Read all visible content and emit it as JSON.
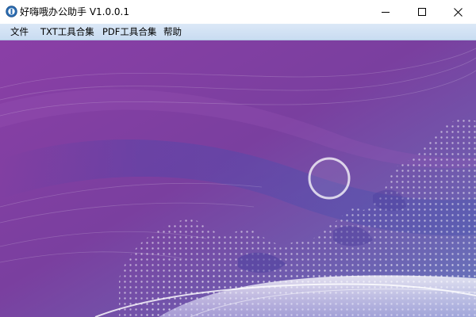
{
  "window": {
    "title": "好嗨哦办公助手 V1.0.0.1",
    "app_icon": "app-icon",
    "controls": {
      "minimize_icon": "minimize-icon",
      "maximize_icon": "maximize-icon",
      "close_icon": "close-icon"
    }
  },
  "menu": {
    "items": [
      {
        "label": "文件"
      },
      {
        "label": "TXT工具合集"
      },
      {
        "label": "PDF工具合集"
      },
      {
        "label": "帮助"
      }
    ]
  },
  "colors": {
    "menubar_top": "#dbe8f7",
    "menubar_bottom": "#c9dcf1",
    "background_purple": "#7a3fa0",
    "background_blue": "#6a78c0"
  }
}
